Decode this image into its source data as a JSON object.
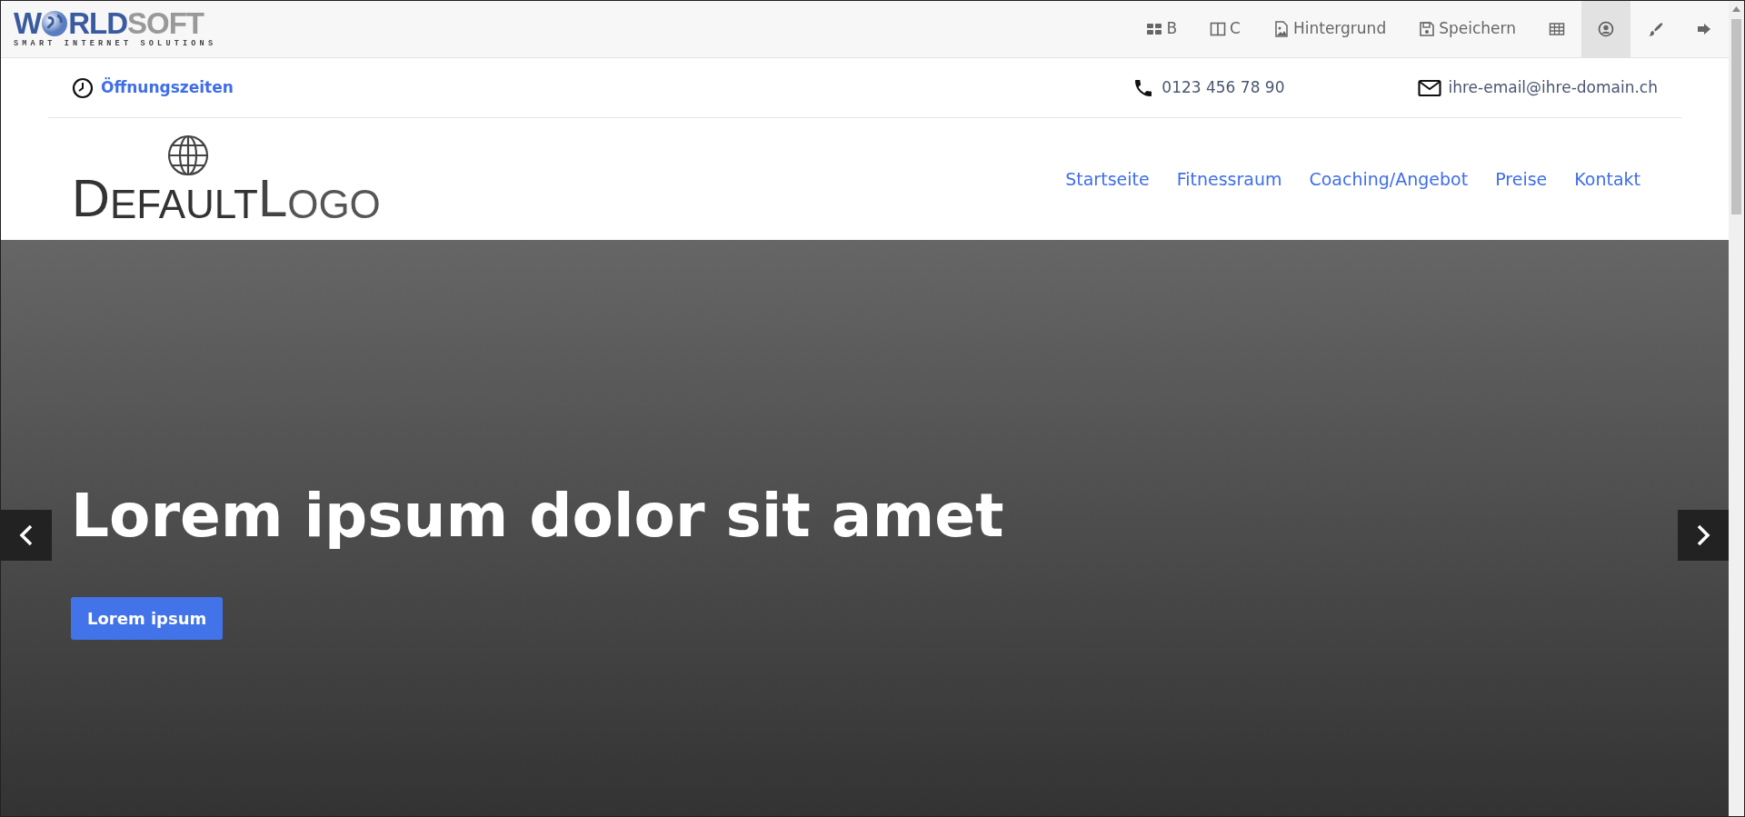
{
  "brand": {
    "name_start": "W",
    "name_blue": "RLD",
    "name_grey": "SOFT",
    "tagline": "SMART INTERNET SOLUTIONS"
  },
  "toolbar": [
    {
      "kind": "grid",
      "label": "B",
      "selected": false
    },
    {
      "kind": "columns",
      "label": "C",
      "selected": false
    },
    {
      "kind": "image",
      "label": "Hintergrund",
      "selected": false
    },
    {
      "kind": "save",
      "label": "Speichern",
      "selected": false
    },
    {
      "kind": "table",
      "selected": false
    },
    {
      "kind": "user",
      "selected": true
    },
    {
      "kind": "brush",
      "selected": false
    },
    {
      "kind": "logout",
      "selected": false
    }
  ],
  "topbar": {
    "hours": "Öffnungszeiten",
    "phone": "0123 456 78 90",
    "email": "ihre-email@ihre-domain.ch"
  },
  "logo": {
    "parts": [
      {
        "text": "D",
        "kind": "big"
      },
      {
        "text": "EFAULT",
        "kind": "small"
      },
      {
        "text": "L",
        "kind": "thinbig"
      },
      {
        "text": "OGO",
        "kind": "thin"
      }
    ]
  },
  "nav": [
    "Startseite",
    "Fitnessraum",
    "Coaching/Angebot",
    "Preise",
    "Kontakt"
  ],
  "hero": {
    "title": "Lorem ipsum dolor sit amet",
    "button": "Lorem ipsum"
  }
}
